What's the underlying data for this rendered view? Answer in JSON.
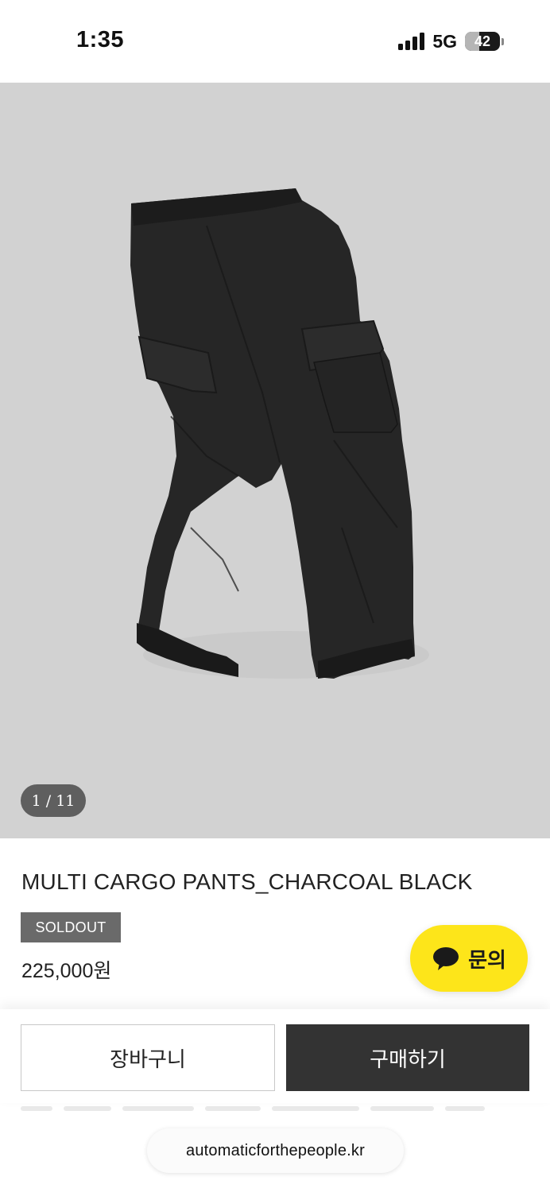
{
  "status_bar": {
    "time": "1:35",
    "network": "5G",
    "battery_percent": 42,
    "battery_text": "42",
    "icons": [
      "signal-icon",
      "battery-icon"
    ]
  },
  "gallery": {
    "counter": "1 / 11",
    "current_index": 1,
    "total_images": 11,
    "background_color": "#d2d2d2",
    "image_subject": "charcoal-black-cargo-pants"
  },
  "product": {
    "title": "MULTI CARGO PANTS_CHARCOAL BLACK",
    "badge": "SOLDOUT",
    "price": "225,000원"
  },
  "chat": {
    "label": "문의",
    "color": "#fde51a",
    "icon": "chat-bubble-icon"
  },
  "actions": {
    "cart_label": "장바구니",
    "buy_label": "구매하기",
    "buy_color": "#333333"
  },
  "browser": {
    "domain": "automaticforthepeople.kr"
  }
}
